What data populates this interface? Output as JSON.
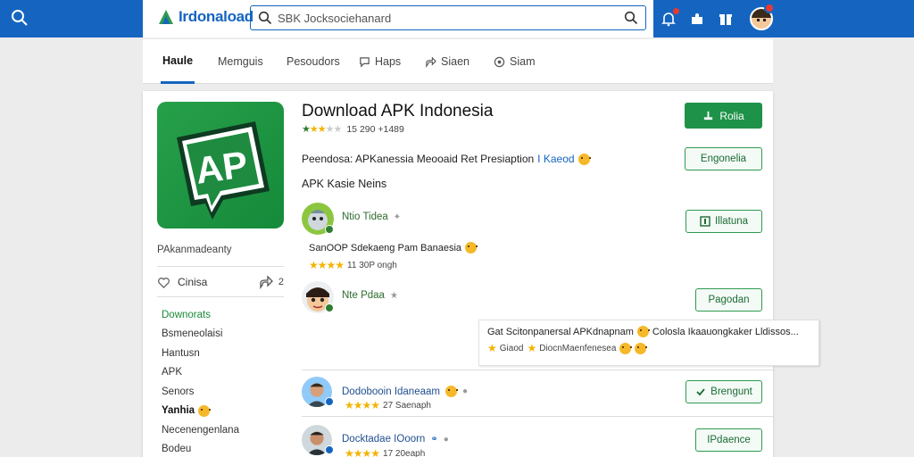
{
  "header": {
    "logo_text": "Irdonaload",
    "search_placeholder": "SBK Jocksociehanard",
    "brand_color": "#1565c0",
    "icons": [
      "search-icon",
      "bell-icon",
      "puzzle-icon",
      "gift-icon",
      "user-avatar"
    ]
  },
  "nav": {
    "tabs": [
      {
        "label": "Haule",
        "active": true
      },
      {
        "label": "Memguis"
      },
      {
        "label": "Pesoudors"
      },
      {
        "label": "Haps",
        "icon": "chat-icon"
      },
      {
        "label": "Siaen",
        "icon": "share-icon"
      },
      {
        "label": "Siam",
        "icon": "globe-icon"
      }
    ]
  },
  "app": {
    "title": "Download APK Indonesia",
    "icon_text": "AP",
    "rating_text": "15  290 +1489",
    "developer": "PAkanmadeanty",
    "description": "Peendosa: APKanessia Meooaid Ret Presiaption",
    "description_highlight": "I Kaeod",
    "like_label": "Cinisa",
    "share_count": "2"
  },
  "sidebar": {
    "items": [
      {
        "label": "Downorats",
        "style": "green"
      },
      {
        "label": "Bsmeneolaisi"
      },
      {
        "label": "Hantusn"
      },
      {
        "label": "APK"
      },
      {
        "label": "Senors"
      },
      {
        "label": "Yanhia",
        "style": "bold",
        "emoji": true
      },
      {
        "label": "Necenengenlana"
      },
      {
        "label": "Bodeu"
      }
    ]
  },
  "buttons": {
    "primary": "Rolia",
    "b1": "Engonelia",
    "b2": "Illatuna",
    "b3": "Pagodan",
    "b4": "Brengunt",
    "b5": "IPdaence"
  },
  "reviews": {
    "section_label": "APK Kasie Neins",
    "r1": {
      "name": "Ntio Tidea",
      "text": "SanOOP Sdekaeng Pam Banaesia",
      "meta": "11 30P ongh"
    },
    "r2": {
      "name": "Nte Pdaa",
      "text": "Gat Scitonpanersal APKdnapnam",
      "text2": "Colosla Ikaauongkaker Lldissos...",
      "meta": "Giaod",
      "meta2": "DiocnMaenfenesea"
    },
    "r3": {
      "name": "Dodobooin Idaneaam",
      "meta": "27 Saenaph"
    },
    "r4": {
      "name": "Docktadae IOoorn",
      "meta": "17 20eaph"
    }
  }
}
